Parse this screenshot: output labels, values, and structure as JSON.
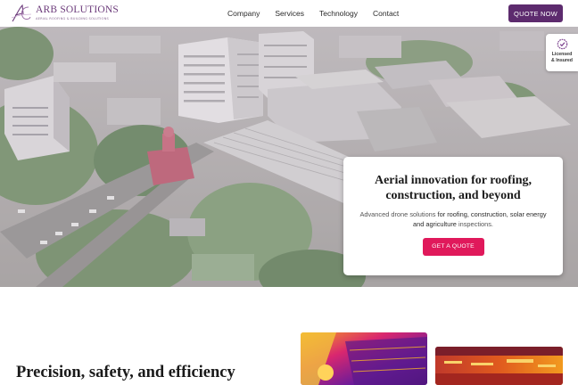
{
  "brand": {
    "name": "ARB SOLUTIONS",
    "tagline": "AERIAL ROOFING & BUILDING SOLUTIONS",
    "accent": "#5d2b6e",
    "cta_color": "#e0195b"
  },
  "nav": {
    "items": [
      {
        "label": "Company"
      },
      {
        "label": "Services"
      },
      {
        "label": "Technology"
      },
      {
        "label": "Contact"
      }
    ],
    "quote_button": "QUOTE NOW"
  },
  "badge": {
    "icon": "check-shield-icon",
    "line1": "Licensed",
    "line2": "& Insured"
  },
  "hero": {
    "image": "aerial-city-photo",
    "title": "Aerial innovation for roofing, construction, and beyond",
    "subtitle_pre": "Advanced drone solutions ",
    "subtitle_highlight": "for roofing, construction, solar energy and agriculture",
    "subtitle_post": " inspections.",
    "cta": "GET A QUOTE"
  },
  "section": {
    "title": "Precision, safety, and efficiency",
    "images": [
      "thermal-roof-image-1",
      "thermal-roof-image-2"
    ]
  }
}
